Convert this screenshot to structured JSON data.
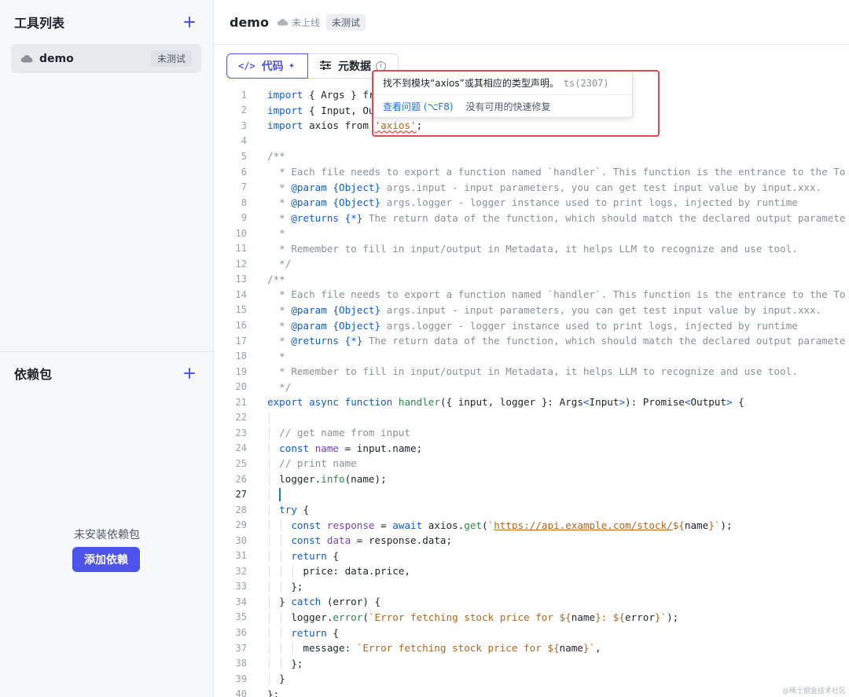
{
  "sidebar": {
    "tools_title": "工具列表",
    "tool_item": {
      "name": "demo",
      "badge": "未测试"
    },
    "deps_title": "依赖包",
    "empty_text": "未安装依赖包",
    "add_dep_label": "添加依赖"
  },
  "header": {
    "title": "demo",
    "status": "未上线",
    "badge": "未测试"
  },
  "tabs": [
    {
      "label": "代码",
      "icon": "code-icon"
    },
    {
      "label": "元数据",
      "icon": "sliders-icon"
    }
  ],
  "popup": {
    "message": "找不到模块“axios”或其相应的类型声明。",
    "code": "ts(2307)",
    "view_problem": "查看问题 (⌥F8)",
    "no_fix": "没有可用的快速修复"
  },
  "watermark": "@稀土掘金技术社区",
  "active_line": 27,
  "colors": {
    "accent": "#4d53e8",
    "error": "#e5484d",
    "link": "#1a73e8"
  },
  "code_lines": [
    {
      "n": 1,
      "text": "import { Args } fr"
    },
    {
      "n": 2,
      "text": "import { Input, Ou"
    },
    {
      "n": 3,
      "text": "import axios from 'axios';"
    },
    {
      "n": 4,
      "text": ""
    },
    {
      "n": 5,
      "text": "/**"
    },
    {
      "n": 6,
      "text": "  * Each file needs to export a function named `handler`. This function is the entrance to the To"
    },
    {
      "n": 7,
      "text": "  * @param {Object} args.input - input parameters, you can get test input value by input.xxx."
    },
    {
      "n": 8,
      "text": "  * @param {Object} args.logger - logger instance used to print logs, injected by runtime"
    },
    {
      "n": 9,
      "text": "  * @returns {*} The return data of the function, which should match the declared output paramete"
    },
    {
      "n": 10,
      "text": "  *"
    },
    {
      "n": 11,
      "text": "  * Remember to fill in input/output in Metadata, it helps LLM to recognize and use tool."
    },
    {
      "n": 12,
      "text": "  */"
    },
    {
      "n": 13,
      "text": "/**"
    },
    {
      "n": 14,
      "text": "  * Each file needs to export a function named `handler`. This function is the entrance to the To"
    },
    {
      "n": 15,
      "text": "  * @param {Object} args.input - input parameters, you can get test input value by input.xxx."
    },
    {
      "n": 16,
      "text": "  * @param {Object} args.logger - logger instance used to print logs, injected by runtime"
    },
    {
      "n": 17,
      "text": "  * @returns {*} The return data of the function, which should match the declared output paramete"
    },
    {
      "n": 18,
      "text": "  *"
    },
    {
      "n": 19,
      "text": "  * Remember to fill in input/output in Metadata, it helps LLM to recognize and use tool."
    },
    {
      "n": 20,
      "text": "  */"
    },
    {
      "n": 21,
      "text": "export async function handler({ input, logger }: Args<Input>): Promise<Output> {"
    },
    {
      "n": 22,
      "text": ""
    },
    {
      "n": 23,
      "text": "  // get name from input"
    },
    {
      "n": 24,
      "text": "  const name = input.name;"
    },
    {
      "n": 25,
      "text": "  // print name"
    },
    {
      "n": 26,
      "text": "  logger.info(name);"
    },
    {
      "n": 27,
      "text": ""
    },
    {
      "n": 28,
      "text": "  try {"
    },
    {
      "n": 29,
      "text": "    const response = await axios.get(`https://api.example.com/stock/${name}`);"
    },
    {
      "n": 30,
      "text": "    const data = response.data;"
    },
    {
      "n": 31,
      "text": "    return {"
    },
    {
      "n": 32,
      "text": "      price: data.price,"
    },
    {
      "n": 33,
      "text": "    };"
    },
    {
      "n": 34,
      "text": "  } catch (error) {"
    },
    {
      "n": 35,
      "text": "    logger.error(`Error fetching stock price for ${name}: ${error}`);"
    },
    {
      "n": 36,
      "text": "    return {"
    },
    {
      "n": 37,
      "text": "      message: `Error fetching stock price for ${name}`,"
    },
    {
      "n": 38,
      "text": "    };"
    },
    {
      "n": 39,
      "text": "  }"
    },
    {
      "n": 40,
      "text": "};"
    }
  ]
}
